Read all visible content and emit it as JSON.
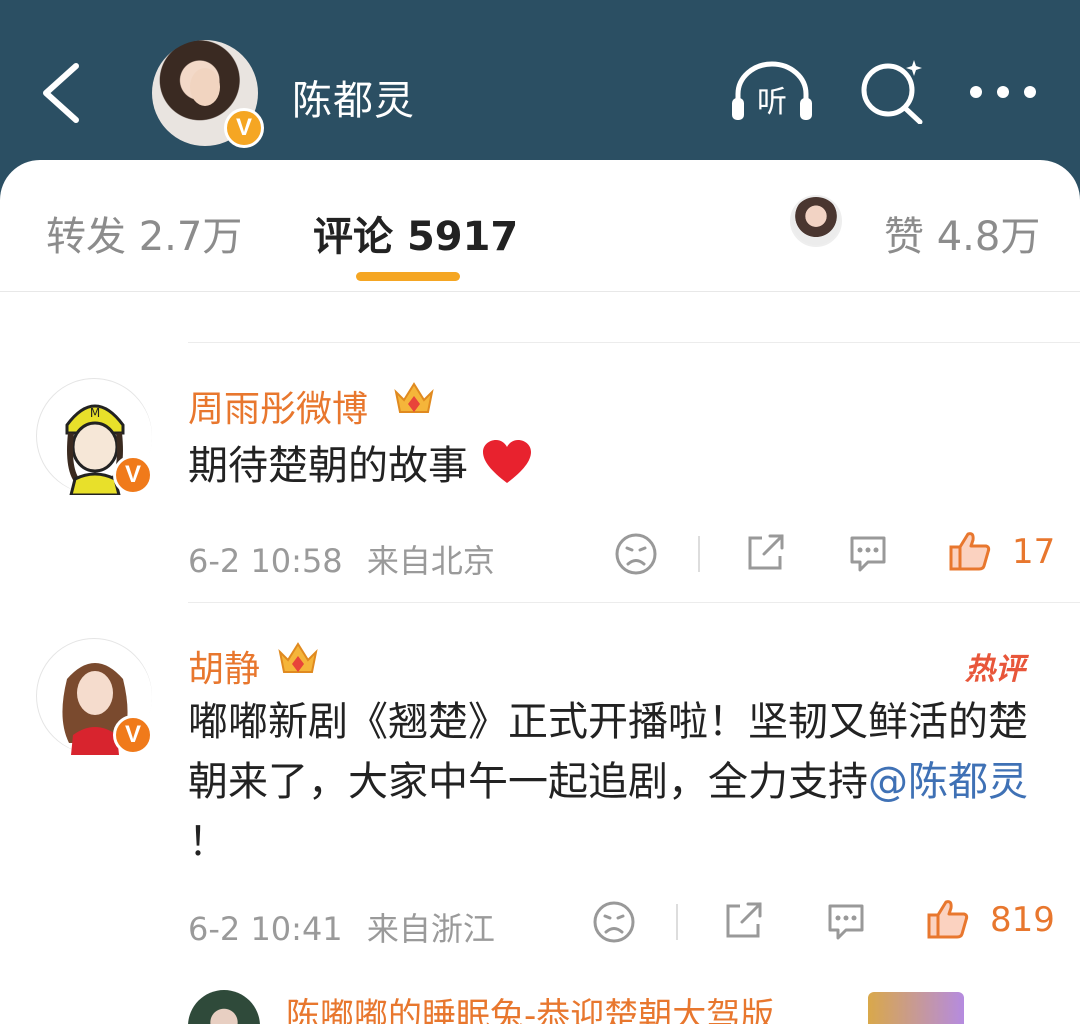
{
  "header": {
    "title": "陈都灵",
    "verified_badge": "V",
    "icons": [
      "back-icon",
      "listen-icon",
      "search-icon",
      "more-icon"
    ],
    "listen_label": "听"
  },
  "tabs": {
    "repost_label": "转发",
    "repost_count": "2.7万",
    "comment_label": "评论",
    "comment_count": "5917",
    "like_label": "赞",
    "like_count": "4.8万"
  },
  "comments": [
    {
      "name": "周雨彤微博",
      "verified_badge": "V",
      "text": "期待楚朝的故事",
      "time": "6-2 10:58",
      "location": "来自北京",
      "like_count": "17"
    },
    {
      "name": "胡静",
      "verified_badge": "V",
      "hot_label": "热评",
      "text_before": "嘟嘟新剧《翘楚》正式开播啦！坚韧又鲜活的楚朝来了，大家中午一起追剧，全力支持",
      "mention": "@陈都灵",
      "text_after": " ！",
      "time": "6-2 10:41",
      "location": "来自浙江",
      "like_count": "819"
    }
  ],
  "next_comment": {
    "name": "陈嘟嘟的睡眠兔-恭迎楚朝大驾版"
  },
  "colors": {
    "header_bg": "#2b4f63",
    "accent": "#f5a623",
    "name_orange": "#e8772e",
    "mention_blue": "#3f71b5"
  }
}
